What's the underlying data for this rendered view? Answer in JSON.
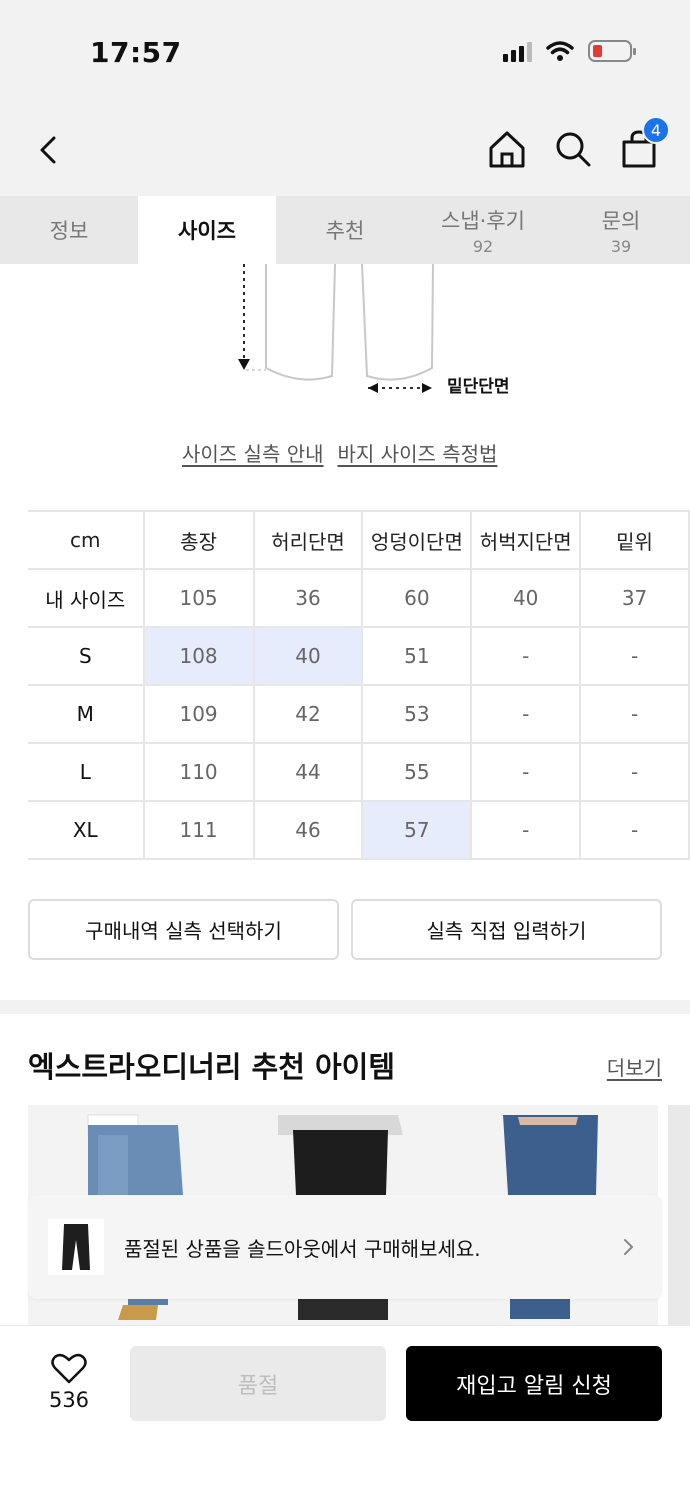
{
  "status_bar": {
    "time": "17:57",
    "icons": [
      "signal-icon",
      "wifi-icon",
      "battery-low-icon"
    ]
  },
  "header": {
    "icons": [
      "back-chevron-icon",
      "home-icon",
      "search-icon",
      "shopping-bag-icon"
    ],
    "cart_count": "4"
  },
  "tabs": [
    {
      "label": "정보",
      "count": ""
    },
    {
      "label": "사이즈",
      "count": ""
    },
    {
      "label": "추천",
      "count": ""
    },
    {
      "label": "스냅·후기",
      "count": "92"
    },
    {
      "label": "문의",
      "count": "39"
    }
  ],
  "diagram": {
    "label": "밑단단면"
  },
  "guide_links": {
    "fit_guide": "사이즈 실측 안내",
    "measure_guide": "바지 사이즈 측정법"
  },
  "size_table": {
    "headers": [
      "cm",
      "총장",
      "허리단면",
      "엉덩이단면",
      "허벅지단면",
      "밑위"
    ],
    "rows": [
      {
        "label": "내 사이즈",
        "values": [
          "105",
          "36",
          "60",
          "40",
          "37"
        ]
      },
      {
        "label": "S",
        "values": [
          "108",
          "40",
          "51",
          "-",
          "-"
        ]
      },
      {
        "label": "M",
        "values": [
          "109",
          "42",
          "53",
          "-",
          "-"
        ]
      },
      {
        "label": "L",
        "values": [
          "110",
          "44",
          "55",
          "-",
          "-"
        ]
      },
      {
        "label": "XL",
        "values": [
          "111",
          "46",
          "57",
          "-",
          "-"
        ]
      }
    ],
    "highlight_color": "#e6ecfc"
  },
  "actions": {
    "purchase_history": "구매내역 실측 선택하기",
    "direct_input": "실측 직접 입력하기"
  },
  "recommend": {
    "title": "엑스트라오디너리 추천 아이템",
    "more": "더보기"
  },
  "soldout_banner": {
    "text": "품절된 상품을 솔드아웃에서 구매해보세요."
  },
  "bottom_bar": {
    "like_count": "536",
    "soldout_label": "품절",
    "restock_label": "재입고 알림 신청"
  }
}
